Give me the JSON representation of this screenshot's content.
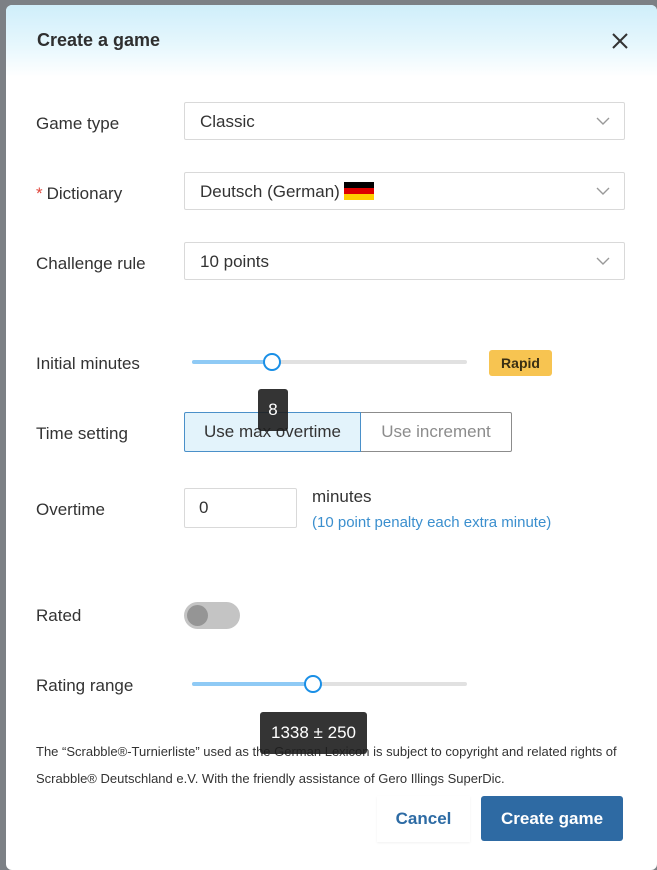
{
  "dialog": {
    "title": "Create a game",
    "close_icon": "close-icon"
  },
  "form": {
    "game_type": {
      "label": "Game type",
      "value": "Classic"
    },
    "dictionary": {
      "required_mark": "*",
      "label": "Dictionary",
      "value": "Deutsch (German)",
      "flag_icon": "german-flag-icon"
    },
    "challenge_rule": {
      "label": "Challenge rule",
      "value": "10 points"
    },
    "initial_minutes": {
      "label": "Initial minutes",
      "value": "8",
      "badge": "Rapid",
      "slider_fraction": 0.29
    },
    "time_setting": {
      "label": "Time setting",
      "options": [
        "Use max overtime",
        "Use increment"
      ],
      "selected": "Use max overtime"
    },
    "overtime": {
      "label": "Overtime",
      "value": "0",
      "unit": "minutes",
      "note": "(10 point penalty each extra minute)"
    },
    "rated": {
      "label": "Rated",
      "enabled": false
    },
    "rating_range": {
      "label": "Rating range",
      "value": "1338 ± 250",
      "slider_fraction": 0.44
    }
  },
  "footnote": "The “Scrabble®-Turnierliste” used as the German Lexicon is subject to copyright and related rights of Scrabble® Deutschland e.V. With the friendly assistance of Gero Illings SuperDic.",
  "actions": {
    "cancel": "Cancel",
    "create": "Create game"
  },
  "colors": {
    "primary": "#2e6aa3",
    "link": "#3b8fce",
    "slider_handle": "#1a8fe6",
    "badge": "#f7c451",
    "required": "#e0463c"
  }
}
